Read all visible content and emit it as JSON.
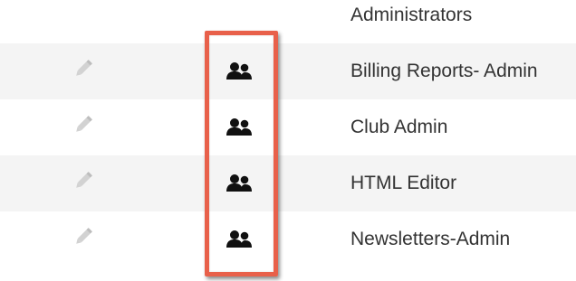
{
  "rows": [
    {
      "name": "Administrators"
    },
    {
      "name": "Billing Reports- Admin"
    },
    {
      "name": "Club Admin"
    },
    {
      "name": "HTML Editor"
    },
    {
      "name": "Newsletters-Admin"
    }
  ],
  "icons": {
    "edit": "pencil-icon",
    "members": "group-icon"
  },
  "colors": {
    "highlight_border": "#e8604a",
    "stripe": "#f4f4f4",
    "text": "#333333",
    "pencil": "#c9c9c9",
    "group_icon": "#111111"
  }
}
